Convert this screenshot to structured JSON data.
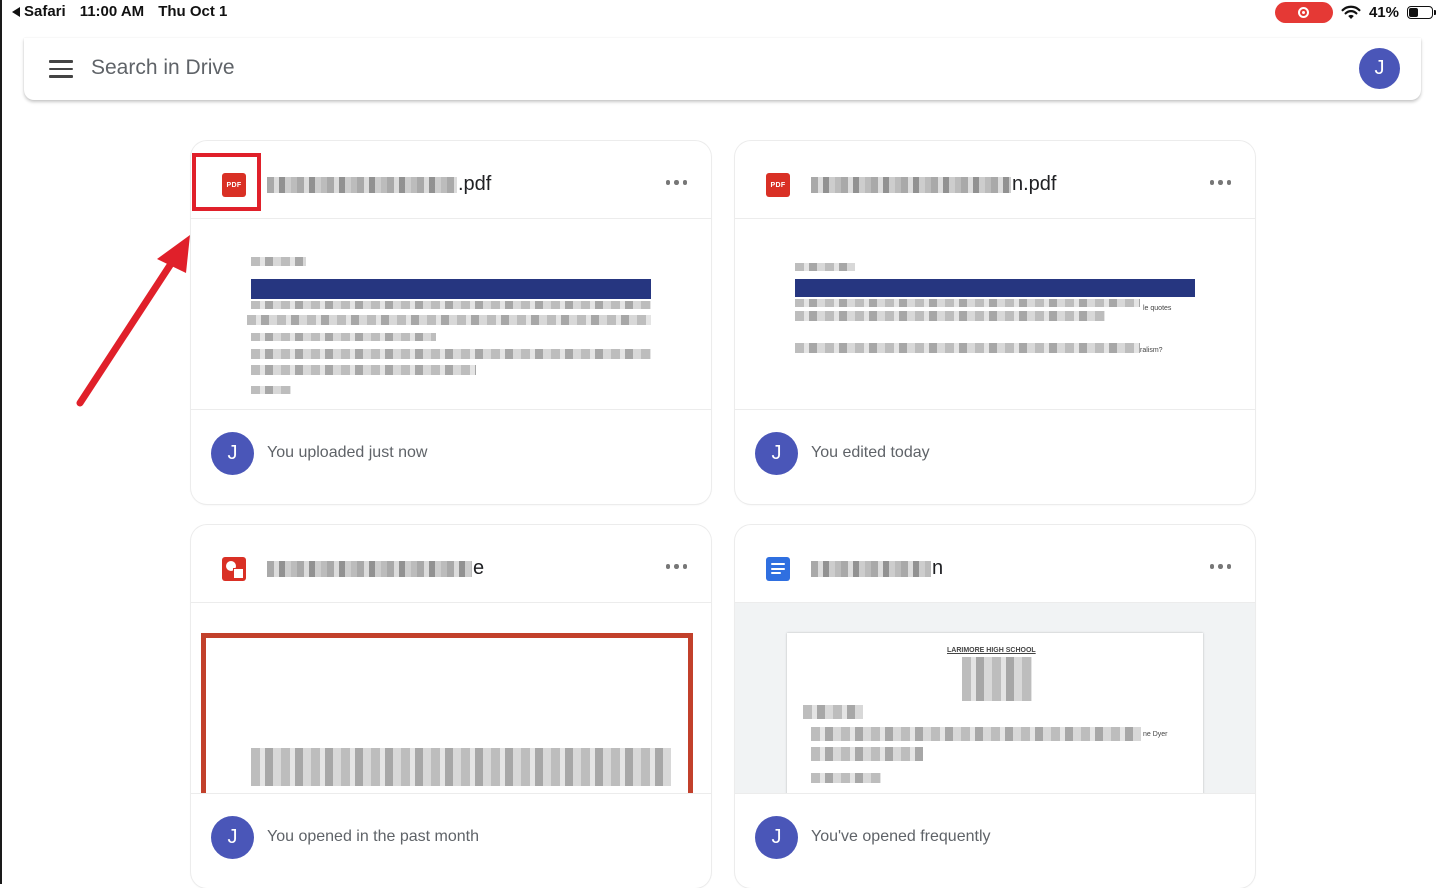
{
  "status_bar": {
    "back_app": "Safari",
    "time": "11:00 AM",
    "date": "Thu Oct 1",
    "battery_percent": "41%",
    "battery_level": 0.41,
    "icons": [
      "back-arrow-icon",
      "screen-record-icon",
      "wifi-icon",
      "battery-icon"
    ]
  },
  "search": {
    "placeholder": "Search in Drive",
    "menu_icon": "hamburger-menu-icon",
    "account_initial": "J"
  },
  "colors": {
    "avatar": "#4a56b8",
    "pdf_red": "#d93025",
    "docs_blue": "#2f6fe0",
    "annotation_red": "#e0202a",
    "slides_frame": "#c2402b"
  },
  "files": [
    {
      "type": "pdf",
      "icon": "pdf-icon",
      "icon_label": "PDF",
      "name_visible_suffix": ".pdf",
      "name_redacted": true,
      "activity": "You uploaded just now",
      "user_initial": "J",
      "highlighted": true
    },
    {
      "type": "pdf",
      "icon": "pdf-icon",
      "icon_label": "PDF",
      "name_visible_suffix": "n.pdf",
      "name_redacted": true,
      "activity": "You edited today",
      "user_initial": "J",
      "preview_snippets": [
        "le quotes",
        "ralism?"
      ]
    },
    {
      "type": "slides",
      "icon": "slides-icon",
      "name_visible_suffix": "e",
      "name_redacted": true,
      "activity": "You opened in the past month",
      "user_initial": "J"
    },
    {
      "type": "doc",
      "icon": "docs-icon",
      "name_visible_suffix": "n",
      "name_redacted": true,
      "activity": "You've opened frequently",
      "user_initial": "J",
      "preview_snippets": [
        "LARIMORE HIGH SCHOOL",
        "ne Dyer"
      ]
    }
  ],
  "more_options_icon": "more-horizontal-icon",
  "annotation": {
    "type": "arrow-and-box",
    "target": "first-file-pdf-icon"
  }
}
